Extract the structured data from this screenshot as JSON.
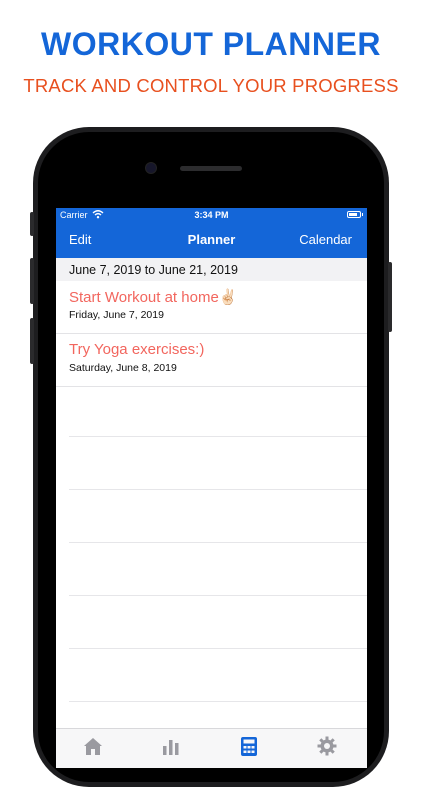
{
  "promo": {
    "title": "WORKOUT PLANNER",
    "subtitle": "TRACK AND CONTROL YOUR PROGRESS",
    "title_color": "#1466d8",
    "subtitle_color": "#e8501f"
  },
  "status_bar": {
    "carrier": "Carrier",
    "time": "3:34 PM",
    "icons": [
      "wifi-icon",
      "battery-icon"
    ]
  },
  "nav_bar": {
    "left_label": "Edit",
    "title": "Planner",
    "right_label": "Calendar",
    "color": "#1466d8"
  },
  "section": {
    "header": "June 7, 2019 to June 21, 2019"
  },
  "entries": [
    {
      "title": "Start Workout at home✌🏻",
      "date": "Friday, June 7, 2019"
    },
    {
      "title": "Try Yoga exercises:)",
      "date": "Saturday, June 8, 2019"
    }
  ],
  "entry_title_color": "#f2665e",
  "tab_bar": {
    "items": [
      {
        "icon": "home-icon",
        "selected": false
      },
      {
        "icon": "bar-chart-icon",
        "selected": false
      },
      {
        "icon": "calculator-icon",
        "selected": true
      },
      {
        "icon": "gear-icon",
        "selected": false
      }
    ]
  }
}
